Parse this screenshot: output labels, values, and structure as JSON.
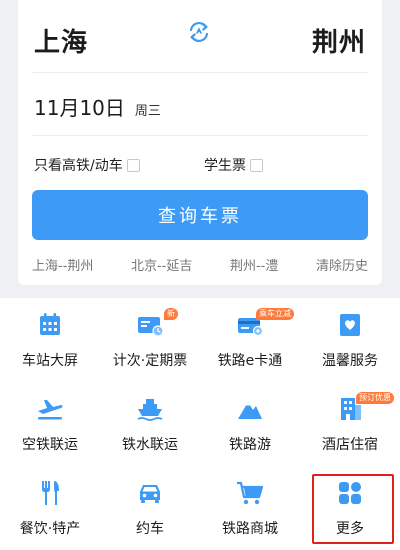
{
  "route": {
    "from": "上海",
    "to": "荆州",
    "swap_icon": "swap-arrows-icon"
  },
  "date": {
    "main": "11月10日",
    "weekday": "周三"
  },
  "options": {
    "fast_train_label": "只看高铁/动车",
    "fast_train_checked": false,
    "student_label": "学生票",
    "student_checked": false
  },
  "query_button": "查询车票",
  "history": {
    "items": [
      "上海--荆州",
      "北京--延吉",
      "荆州--澧"
    ],
    "clear_label": "清除历史"
  },
  "services": [
    {
      "label": "车站大屏",
      "icon": "station-screen-icon",
      "badge": ""
    },
    {
      "label": "计次·定期票",
      "icon": "periodic-ticket-icon",
      "badge": "新"
    },
    {
      "label": "铁路e卡通",
      "icon": "rail-ecard-icon",
      "badge": "乘车立减"
    },
    {
      "label": "温馨服务",
      "icon": "care-service-icon",
      "badge": ""
    },
    {
      "label": "空铁联运",
      "icon": "air-rail-icon",
      "badge": ""
    },
    {
      "label": "铁水联运",
      "icon": "rail-ship-icon",
      "badge": ""
    },
    {
      "label": "铁路游",
      "icon": "rail-tour-icon",
      "badge": ""
    },
    {
      "label": "酒店住宿",
      "icon": "hotel-icon",
      "badge": "预订优惠"
    },
    {
      "label": "餐饮·特产",
      "icon": "dining-icon",
      "badge": ""
    },
    {
      "label": "约车",
      "icon": "car-icon",
      "badge": ""
    },
    {
      "label": "铁路商城",
      "icon": "shopping-cart-icon",
      "badge": ""
    },
    {
      "label": "更多",
      "icon": "more-grid-icon",
      "badge": ""
    }
  ],
  "colors": {
    "accent": "#3d9bf5",
    "badge": "#ff7a3a",
    "highlight": "#e21f1f"
  }
}
